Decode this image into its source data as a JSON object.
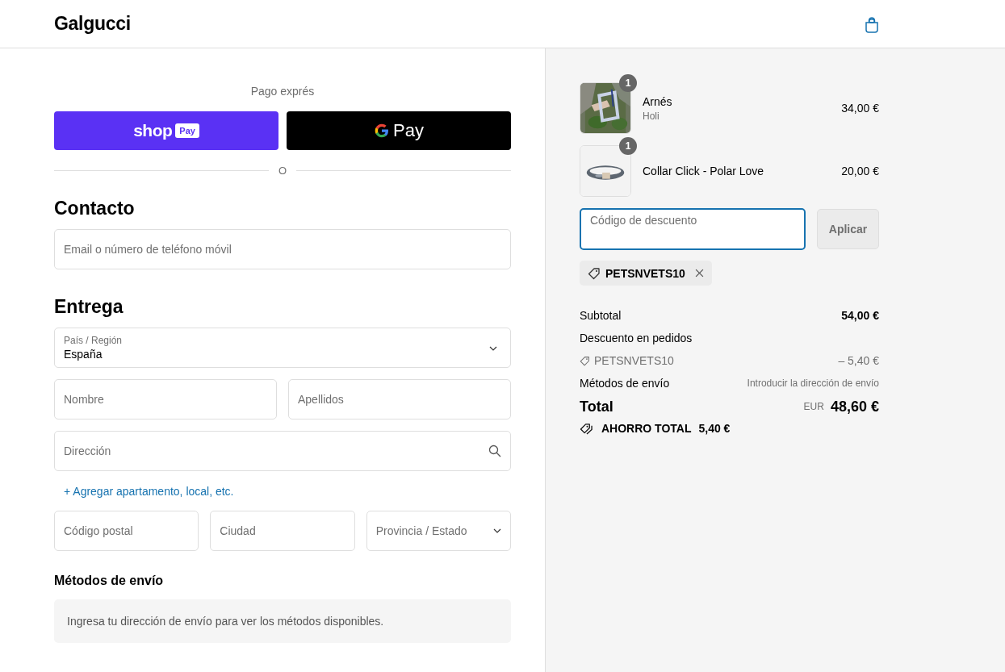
{
  "header": {
    "brand": "Galgucci"
  },
  "express": {
    "title": "Pago exprés",
    "buttons": [
      {
        "kind": "shop",
        "label": "shop",
        "badge": "Pay"
      },
      {
        "kind": "gpay",
        "label": "Pay"
      }
    ],
    "divider": "O"
  },
  "contact": {
    "heading": "Contacto",
    "email": {
      "placeholder": "Email o número de teléfono móvil"
    }
  },
  "delivery": {
    "heading": "Entrega",
    "country": {
      "label": "País / Región",
      "value": "España"
    },
    "rows": [
      [
        {
          "kind": "text",
          "placeholder": "Nombre"
        },
        {
          "kind": "text",
          "placeholder": "Apellidos"
        }
      ],
      [
        {
          "kind": "search",
          "placeholder": "Dirección"
        }
      ]
    ],
    "add_link": {
      "icon": "+",
      "label": "Agregar apartamento, local, etc."
    },
    "city_row": [
      {
        "kind": "text",
        "placeholder": "Código postal"
      },
      {
        "kind": "text",
        "placeholder": "Ciudad"
      },
      {
        "kind": "select",
        "placeholder": "Provincia / Estado"
      }
    ]
  },
  "shipping": {
    "heading": "Métodos de envío",
    "notice": "Ingresa tu dirección de envío para ver los métodos disponibles."
  },
  "summary": {
    "items": [
      {
        "name": "Arnés",
        "variant": "Holi",
        "price": "34,00 €",
        "quantity": "1",
        "kind": "harness"
      },
      {
        "name": "Collar Click - Polar Love",
        "price": "20,00 €",
        "quantity": "1",
        "kind": "collar"
      }
    ],
    "discount": {
      "placeholder": "Código de descuento",
      "focused": true,
      "button": "Aplicar"
    },
    "applied_codes": [
      {
        "code": "PETSNVETS10"
      }
    ],
    "lines": [
      {
        "kind": "subtotal",
        "label": "Subtotal",
        "value": "54,00 €"
      },
      {
        "kind": "heading",
        "label": "Descuento en pedidos"
      },
      {
        "kind": "code",
        "label": "PETSNVETS10",
        "value": "– 5,40 €"
      },
      {
        "kind": "note",
        "label": "Métodos de envío",
        "value": "Introducir la dirección de envío"
      }
    ],
    "total": {
      "label": "Total",
      "currency": "EUR",
      "value": "48,60 €"
    },
    "savings": {
      "label": "AHORRO TOTAL",
      "value": "5,40 €"
    }
  }
}
